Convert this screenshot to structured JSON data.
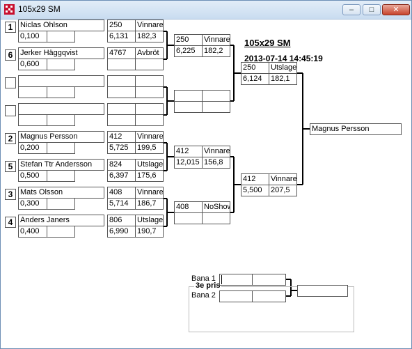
{
  "window": {
    "title": "105x29 SM"
  },
  "header": {
    "title": "105x29 SM",
    "datetime": "2013-07-14 14:45:19"
  },
  "controls": {
    "minimize": "–",
    "maximize": "□",
    "close": "✕"
  },
  "round1": [
    {
      "seed": "1",
      "name": "Niclas Ohlson",
      "rt": "0,100",
      "speed": "250",
      "status": "Vinnare",
      "et": "6,131",
      "mph": "182,3"
    },
    {
      "seed": "6",
      "name": "Jerker Häggqvist",
      "rt": "0,600",
      "speed": "4767",
      "status": "Avbröt",
      "et": "",
      "mph": ""
    },
    {
      "seed": "",
      "name": "",
      "rt": "",
      "speed": "",
      "status": "",
      "et": "",
      "mph": ""
    },
    {
      "seed": "",
      "name": "",
      "rt": "",
      "speed": "",
      "status": "",
      "et": "",
      "mph": ""
    },
    {
      "seed": "2",
      "name": "Magnus Persson",
      "rt": "0,200",
      "speed": "412",
      "status": "Vinnare",
      "et": "5,725",
      "mph": "199,5"
    },
    {
      "seed": "5",
      "name": "Stefan Ttr Andersson",
      "rt": "0,500",
      "speed": "824",
      "status": "Utslager",
      "et": "6,397",
      "mph": "175,6"
    },
    {
      "seed": "3",
      "name": "Mats Olsson",
      "rt": "0,300",
      "speed": "408",
      "status": "Vinnare",
      "et": "5,714",
      "mph": "186,7"
    },
    {
      "seed": "4",
      "name": "Anders Janers",
      "rt": "0,400",
      "speed": "806",
      "status": "Utslager",
      "et": "6,990",
      "mph": "190,7"
    }
  ],
  "round2": [
    {
      "speed": "250",
      "status": "Vinnare",
      "et": "6,225",
      "mph": "182,2"
    },
    {
      "speed": "",
      "status": "",
      "et": "",
      "mph": ""
    },
    {
      "speed": "412",
      "status": "Vinnare",
      "et": "12,015",
      "mph": "156,8"
    },
    {
      "speed": "408",
      "status": "NoShow",
      "et": "",
      "mph": ""
    }
  ],
  "round3": [
    {
      "speed": "250",
      "status": "Utslager",
      "et": "6,124",
      "mph": "182,1"
    },
    {
      "speed": "412",
      "status": "Vinnare",
      "et": "5,500",
      "mph": "207,5"
    }
  ],
  "winner": {
    "name": "Magnus Persson"
  },
  "third_place": {
    "legend": "3e pris",
    "lane1_label": "Bana 1",
    "lane2_label": "Bana 2",
    "lane1": {
      "a": "",
      "b": ""
    },
    "lane2": {
      "a": "",
      "b": ""
    },
    "result": ""
  }
}
